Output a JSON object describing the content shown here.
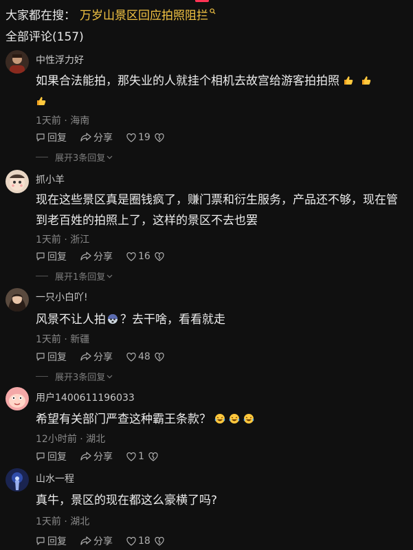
{
  "header": {
    "search_prefix": "大家都在搜：",
    "search_query": "万岁山景区回应拍照阻拦",
    "comments_title": "全部评论(157)"
  },
  "comments": [
    {
      "username": "中性浮力好",
      "content": "如果合法能拍，那失业的人就挂个相机去故宫给游客拍拍照",
      "emojis": [
        "thumbs-up",
        "thumbs-up",
        "thumbs-up"
      ],
      "meta": "1天前 · 海南",
      "reply_label": "回复",
      "share_label": "分享",
      "likes": "19",
      "expand_label": "展开3条回复"
    },
    {
      "username": "抓小羊",
      "content": "现在这些景区真是圈钱疯了，赚门票和衍生服务，产品还不够，现在管到老百姓的拍照上了，这样的景区不去也罢",
      "meta": "1天前 · 浙江",
      "reply_label": "回复",
      "share_label": "分享",
      "likes": "16",
      "expand_label": "展开1条回复"
    },
    {
      "username": "一只小白吖!",
      "content_before": "风景不让人拍",
      "content_after": "？去干啥，看看就走",
      "emojis": [
        "scared-face"
      ],
      "meta": "1天前 · 新疆",
      "reply_label": "回复",
      "share_label": "分享",
      "likes": "48",
      "expand_label": "展开3条回复"
    },
    {
      "username": "用户1400611196033",
      "content": "希望有关部门严查这种霸王条款？",
      "emojis": [
        "laughing-crying",
        "laughing-crying",
        "laughing-crying"
      ],
      "meta": "12小时前 · 湖北",
      "reply_label": "回复",
      "share_label": "分享",
      "likes": "1"
    },
    {
      "username": "山水一程",
      "content": "真牛，景区的现在都这么豪横了吗?",
      "meta": "1天前 · 湖北",
      "reply_label": "回复",
      "share_label": "分享",
      "likes": "18"
    }
  ]
}
